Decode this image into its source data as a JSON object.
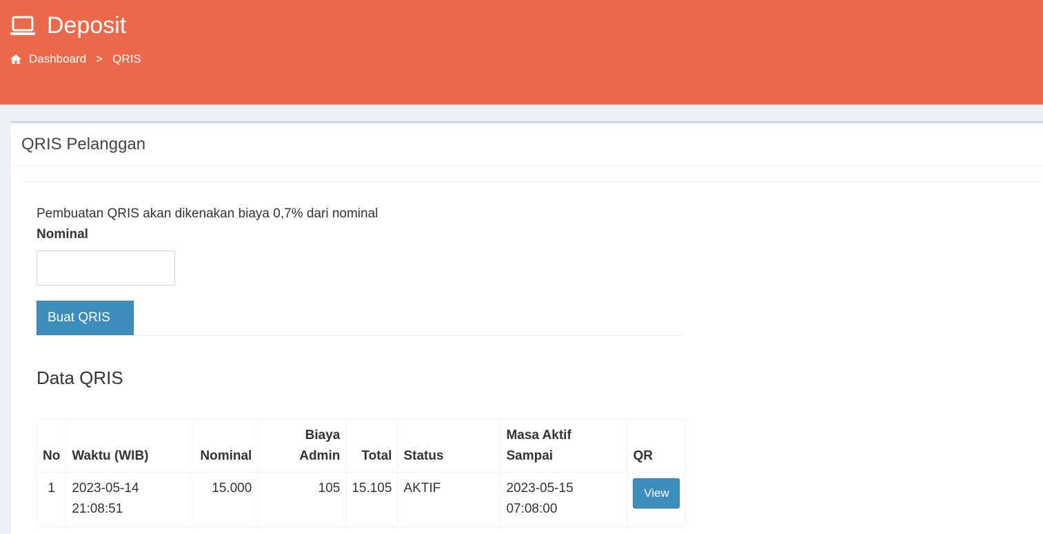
{
  "header": {
    "title": "Deposit",
    "title_icon": "laptop-icon",
    "breadcrumb": {
      "home_icon": "home-icon",
      "dashboard": "Dashboard",
      "separator": ">",
      "current": "QRIS"
    },
    "bg_color": "#ec694b"
  },
  "box": {
    "title": "QRIS Pelanggan",
    "note": "Pembuatan QRIS akan dikenakan biaya 0,7% dari nominal",
    "nominal_label": "Nominal",
    "nominal_value": "",
    "button_label": "Buat QRIS",
    "data_title": "Data QRIS"
  },
  "table": {
    "headers": {
      "no": "No",
      "waktu": "Waktu (WIB)",
      "nominal": "Nominal",
      "biaya_line1": "Biaya",
      "biaya_line2": "Admin",
      "total": "Total",
      "status": "Status",
      "masa_line1": "Masa Aktif",
      "masa_line2": "Sampai",
      "qr": "QR"
    },
    "rows": [
      {
        "no": "1",
        "waktu_date": "2023-05-14",
        "waktu_time": "21:08:51",
        "nominal": "15.000",
        "biaya": "105",
        "total": "15.105",
        "status": "AKTIF",
        "masa_date": "2023-05-15",
        "masa_time": "07:08:00",
        "qr_button": "View"
      }
    ]
  },
  "colors": {
    "primary": "#3c8dbc",
    "header": "#ec694b",
    "background": "#ecf0f5"
  }
}
